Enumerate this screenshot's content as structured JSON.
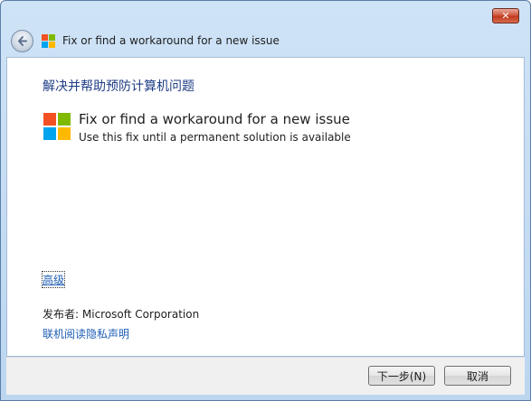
{
  "window": {
    "close_label": "✕"
  },
  "nav": {
    "title": "Fix or find a workaround for a new issue"
  },
  "main": {
    "heading": "解决并帮助预防计算机问题",
    "task_title": "Fix or find a workaround for a new issue",
    "task_description": "Use this fix until a permanent solution is available",
    "advanced_link": "高级",
    "publisher_label": "发布者:",
    "publisher_name": "Microsoft Corporation",
    "privacy_link": "联机阅读隐私声明"
  },
  "footer": {
    "next_label": "下一步(N)",
    "cancel_label": "取消"
  },
  "colors": {
    "logo_red": "#f25022",
    "logo_green": "#7fba00",
    "logo_blue": "#00a4ef",
    "logo_yellow": "#ffb900",
    "heading": "#1e3d84",
    "link": "#1e5eb5"
  }
}
